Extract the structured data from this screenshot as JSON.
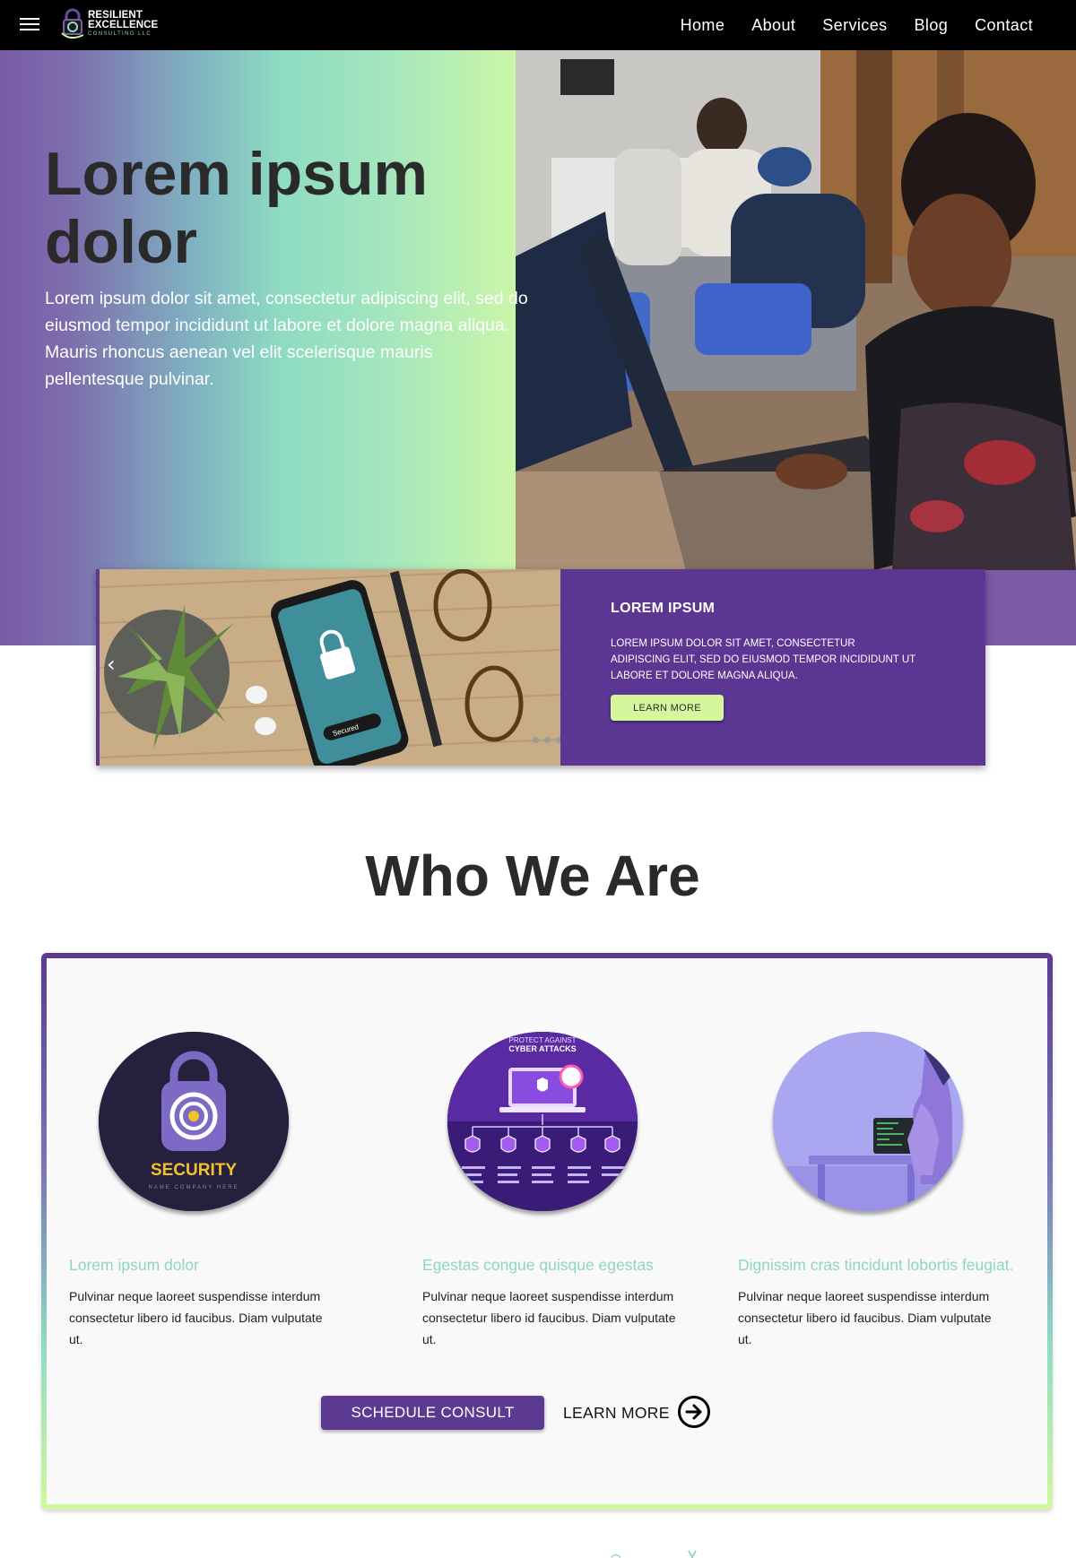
{
  "nav": {
    "logo": {
      "line1": "RESILIENT",
      "line2": "EXCELLENCE",
      "line3": "CONSULTING LLC"
    },
    "links": [
      "Home",
      "About",
      "Services",
      "Blog",
      "Contact"
    ]
  },
  "hero": {
    "title": "Lorem ipsum\ndolor",
    "text": "Lorem ipsum dolor sit amet, consectetur adipiscing elit, sed do eiusmod tempor incididunt ut labore et dolore magna aliqua. Mauris rhoncus aenean vel elit scelerisque mauris pellentesque pulvinar."
  },
  "slider": {
    "prev_glyph": "‹",
    "phone_badge": "Secured",
    "title": "LOREM IPSUM",
    "text": "LOREM IPSUM DOLOR SIT AMET, CONSECTETUR ADIPISCING ELIT, SED DO EIUSMOD TEMPOR INCIDIDUNT UT LABORE ET DOLORE MAGNA ALIQUA.",
    "button": "LEARN MORE",
    "dot_count": 3
  },
  "who": {
    "title": "Who We Are",
    "columns": [
      {
        "image_text": "SECURITY",
        "image_subtext": "NAME COMPANY HERE",
        "title": "Lorem ipsum dolor",
        "text": "Pulvinar neque laoreet suspendisse interdum consectetur libero id faucibus. Diam vulputate ut."
      },
      {
        "image_text": "PROTECT AGAINST",
        "image_subtext": "CYBER ATTACKS",
        "title": "Egestas congue quisque egestas",
        "text": "Pulvinar neque laoreet suspendisse interdum consectetur libero id faucibus. Diam vulputate ut."
      },
      {
        "title": "Dignissim cras tincidunt lobortis feugiat.",
        "text": "Pulvinar neque laoreet suspendisse interdum consectetur libero id faucibus. Diam vulputate ut."
      }
    ],
    "cta_button": "SCHEDULE CONSULT",
    "cta_link": "LEARN MORE"
  },
  "colors": {
    "nav_bg": "#000000",
    "brand_purple": "#5c3693",
    "mint": "#8fd6bf",
    "lime": "#d4f79e"
  }
}
